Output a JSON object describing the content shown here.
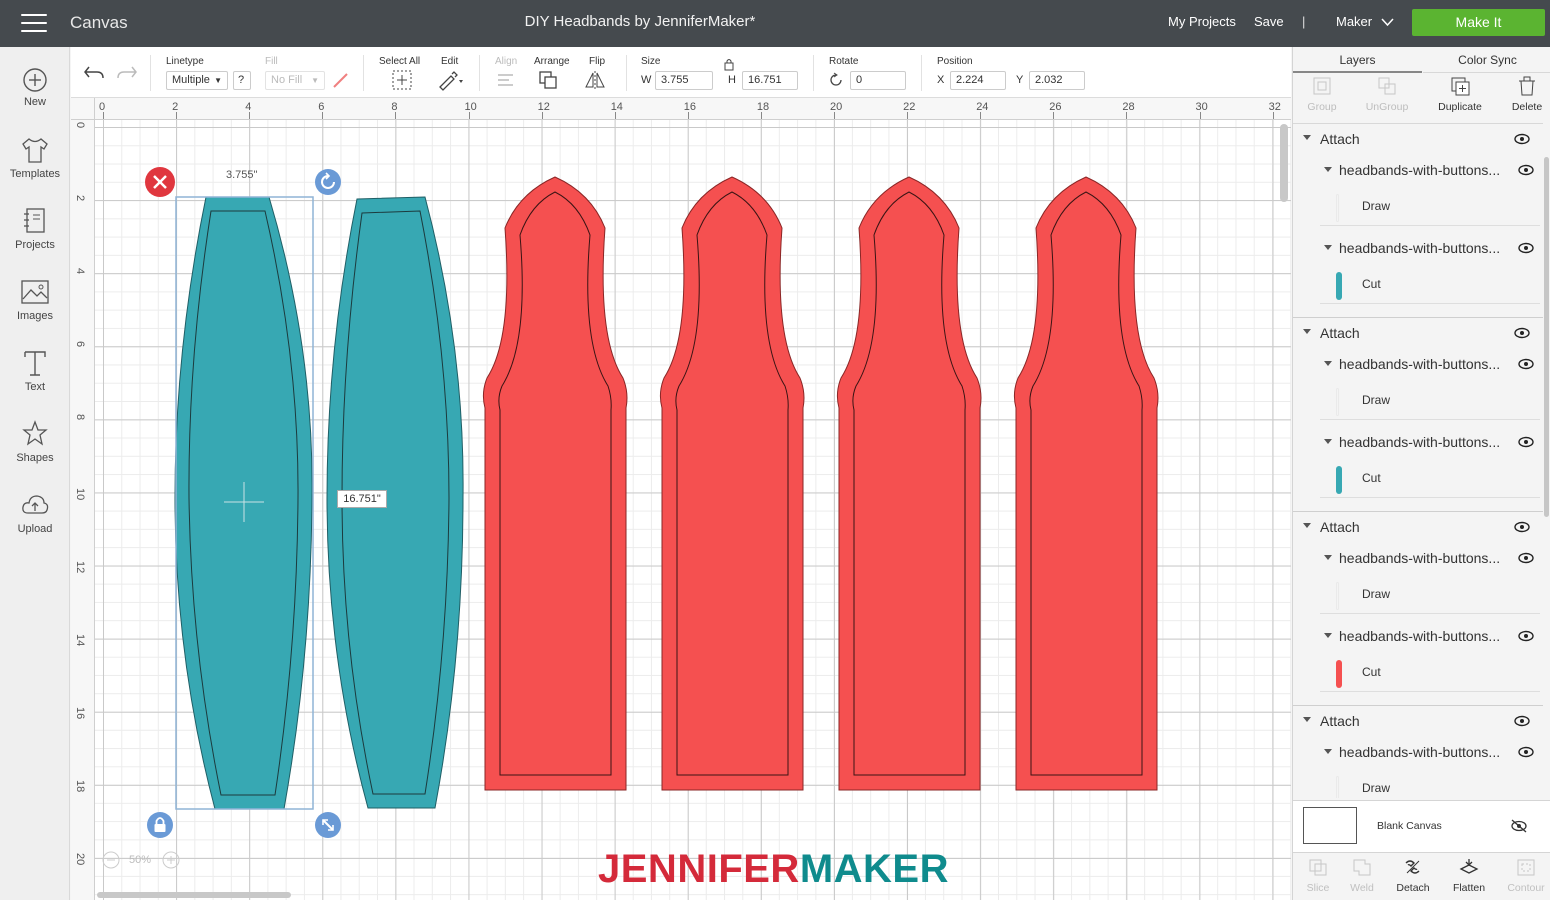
{
  "topbar": {
    "app_title": "Canvas",
    "doc_title": "DIY Headbands by JenniferMaker*",
    "my_projects": "My Projects",
    "save": "Save",
    "separator": "|",
    "machine": "Maker",
    "make_it": "Make It"
  },
  "leftbar": [
    {
      "label": "New",
      "icon": "plus-circle-icon"
    },
    {
      "label": "Templates",
      "icon": "shirt-icon"
    },
    {
      "label": "Projects",
      "icon": "projects-icon"
    },
    {
      "label": "Images",
      "icon": "image-icon"
    },
    {
      "label": "Text",
      "icon": "text-icon"
    },
    {
      "label": "Shapes",
      "icon": "shapes-icon"
    },
    {
      "label": "Upload",
      "icon": "upload-cloud-icon"
    }
  ],
  "toolbar": {
    "linetype_label": "Linetype",
    "linetype_value": "Multiple",
    "help": "?",
    "fill_label": "Fill",
    "fill_value": "No Fill",
    "select_all": "Select All",
    "edit": "Edit",
    "align": "Align",
    "arrange": "Arrange",
    "flip": "Flip",
    "size": "Size",
    "w_label": "W",
    "w_value": "3.755",
    "h_label": "H",
    "h_value": "16.751",
    "rotate": "Rotate",
    "rotate_value": "0",
    "position": "Position",
    "x_label": "X",
    "x_value": "2.224",
    "y_label": "Y",
    "y_value": "2.032"
  },
  "ruler": {
    "top": [
      "0",
      "2",
      "4",
      "6",
      "8",
      "10",
      "12",
      "14",
      "16",
      "18",
      "20",
      "22",
      "24",
      "26",
      "28",
      "30",
      "32"
    ],
    "left": [
      "0",
      "2",
      "4",
      "6",
      "8",
      "10",
      "12",
      "14",
      "16",
      "18",
      "20"
    ]
  },
  "canvas": {
    "width_label": "3.755\"",
    "height_label": "16.751\"",
    "zoom": "50%",
    "colors": {
      "teal": "#37a8b3",
      "red": "#f55050",
      "selection": "#8fb4d6",
      "handle_blue": "#6a9ad6",
      "delete_red": "#e0373f"
    }
  },
  "logo": {
    "part1": "JENNIFER",
    "part2": "MAKER"
  },
  "rightpanel": {
    "tabs": [
      "Layers",
      "Color Sync"
    ],
    "tools": [
      {
        "label": "Group",
        "enabled": false
      },
      {
        "label": "UnGroup",
        "enabled": false
      },
      {
        "label": "Duplicate",
        "enabled": true
      },
      {
        "label": "Delete",
        "enabled": true
      }
    ],
    "groups": [
      {
        "title": "Attach",
        "layers": [
          {
            "title": "headbands-with-buttons...",
            "op": "Draw",
            "color": ""
          },
          {
            "title": "headbands-with-buttons...",
            "op": "Cut",
            "color": "#37a8b3"
          }
        ]
      },
      {
        "title": "Attach",
        "layers": [
          {
            "title": "headbands-with-buttons...",
            "op": "Draw",
            "color": ""
          },
          {
            "title": "headbands-with-buttons...",
            "op": "Cut",
            "color": "#37a8b3"
          }
        ]
      },
      {
        "title": "Attach",
        "layers": [
          {
            "title": "headbands-with-buttons...",
            "op": "Draw",
            "color": ""
          },
          {
            "title": "headbands-with-buttons...",
            "op": "Cut",
            "color": "#f55050"
          }
        ]
      },
      {
        "title": "Attach",
        "layers": [
          {
            "title": "headbands-with-buttons...",
            "op": "Draw",
            "color": ""
          }
        ]
      }
    ],
    "blank_canvas": "Blank Canvas",
    "bottom_tools": [
      {
        "label": "Slice",
        "enabled": false
      },
      {
        "label": "Weld",
        "enabled": false
      },
      {
        "label": "Detach",
        "enabled": true
      },
      {
        "label": "Flatten",
        "enabled": true
      },
      {
        "label": "Contour",
        "enabled": false
      }
    ]
  }
}
